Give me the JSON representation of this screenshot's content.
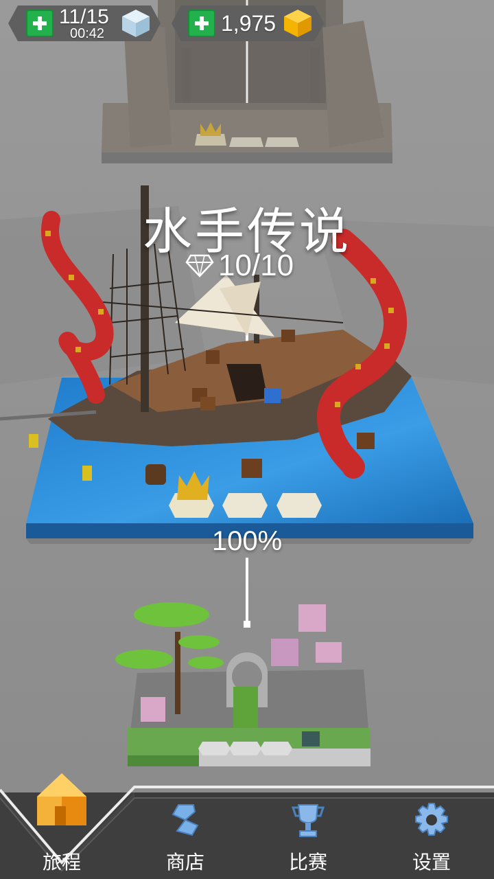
{
  "hud": {
    "lives": {
      "count": "11/15",
      "timer": "00:42",
      "icon": "ice-cube-icon"
    },
    "coins": {
      "count": "1,975",
      "icon": "gold-cube-icon"
    }
  },
  "level": {
    "title": "水手传说",
    "gems": "10/10",
    "progress": "100%"
  },
  "nav": {
    "items": [
      {
        "label": "旅程",
        "icon": "home-icon",
        "active": true
      },
      {
        "label": "商店",
        "icon": "shop-icon",
        "active": false
      },
      {
        "label": "比赛",
        "icon": "trophy-icon",
        "active": false
      },
      {
        "label": "设置",
        "icon": "gear-icon",
        "active": false
      }
    ]
  },
  "colors": {
    "background": "#8e8e8e",
    "water": "#1e7fd0",
    "tentacle": "#cc2b2b",
    "plus_green": "#22b14c",
    "nav_bg": "#3e3e3e",
    "home_orange": "#f5a623"
  }
}
